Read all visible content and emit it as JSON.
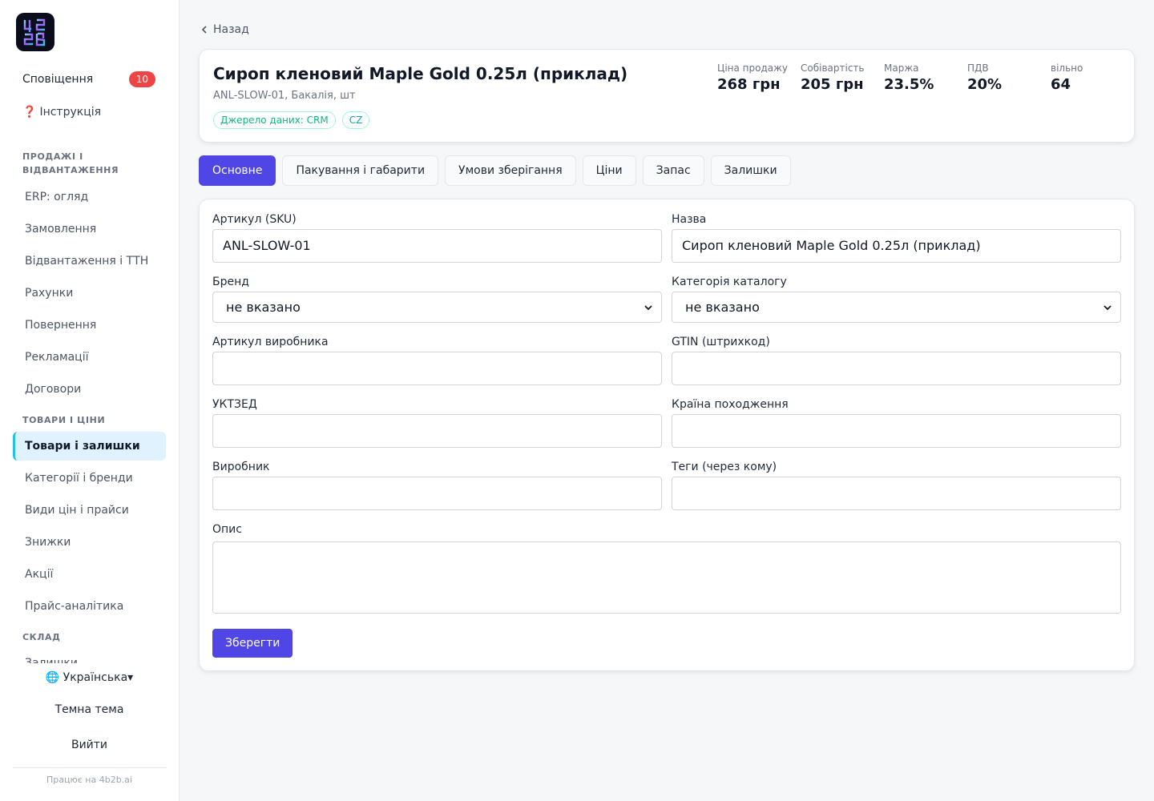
{
  "sidebar": {
    "notifications": {
      "label": "Сповіщення",
      "count": "10"
    },
    "help": {
      "label": "Інструкція"
    },
    "sections": [
      {
        "title": "ПРОДАЖІ І ВІДВАНТАЖЕННЯ",
        "items": [
          "ERP: огляд",
          "Замовлення",
          "Відвантаження і ТТН",
          "Рахунки",
          "Повернення",
          "Рекламації",
          "Договори"
        ]
      },
      {
        "title": "ТОВАРИ І ЦІНИ",
        "items": [
          "Товари і залишки",
          "Категорії і бренди",
          "Види цін і прайси",
          "Знижки",
          "Акції",
          "Прайс-аналітика"
        ]
      },
      {
        "title": "СКЛАД",
        "items": [
          "Залишки"
        ]
      }
    ],
    "active_item": "Товари і залишки",
    "language": "🌐 Українська▾",
    "theme_label": "Темна тема",
    "logout_label": "Вийти",
    "powered_by": "Працює на 4b2b.ai"
  },
  "back_label": "Назад",
  "product": {
    "title": "Сироп кленовий Maple Gold 0.25л (приклад)",
    "subtitle": "ANL-SLOW-01, Бакалія, шт",
    "tags": [
      "Джерело даних: CRM",
      "CZ"
    ],
    "kpis": [
      {
        "label": "Ціна продажу",
        "value": "268 грн"
      },
      {
        "label": "Собівартість",
        "value": "205 грн"
      },
      {
        "label": "Маржа",
        "value": "23.5%"
      },
      {
        "label": "ПДВ",
        "value": "20%"
      },
      {
        "label": "вільно",
        "value": "64"
      }
    ]
  },
  "tabs": [
    "Основне",
    "Пакування і габарити",
    "Умови зберігання",
    "Ціни",
    "Запас",
    "Залишки"
  ],
  "active_tab": "Основне",
  "form": {
    "sku": {
      "label": "Артикул (SKU)",
      "value": "ANL-SLOW-01"
    },
    "name": {
      "label": "Назва",
      "value": "Сироп кленовий Maple Gold 0.25л (приклад)"
    },
    "brand": {
      "label": "Бренд",
      "value": "не вказано"
    },
    "category": {
      "label": "Категорія каталогу",
      "value": "не вказано"
    },
    "manufacturer_sku": {
      "label": "Артикул виробника",
      "value": ""
    },
    "gtin": {
      "label": "GTIN (штрихкод)",
      "value": ""
    },
    "uktzed": {
      "label": "УКТЗЕД",
      "value": ""
    },
    "country": {
      "label": "Країна походження",
      "value": ""
    },
    "manufacturer": {
      "label": "Виробник",
      "value": ""
    },
    "tags": {
      "label": "Теги (через кому)",
      "value": ""
    },
    "description": {
      "label": "Опис",
      "value": ""
    },
    "save_label": "Зберегти"
  }
}
